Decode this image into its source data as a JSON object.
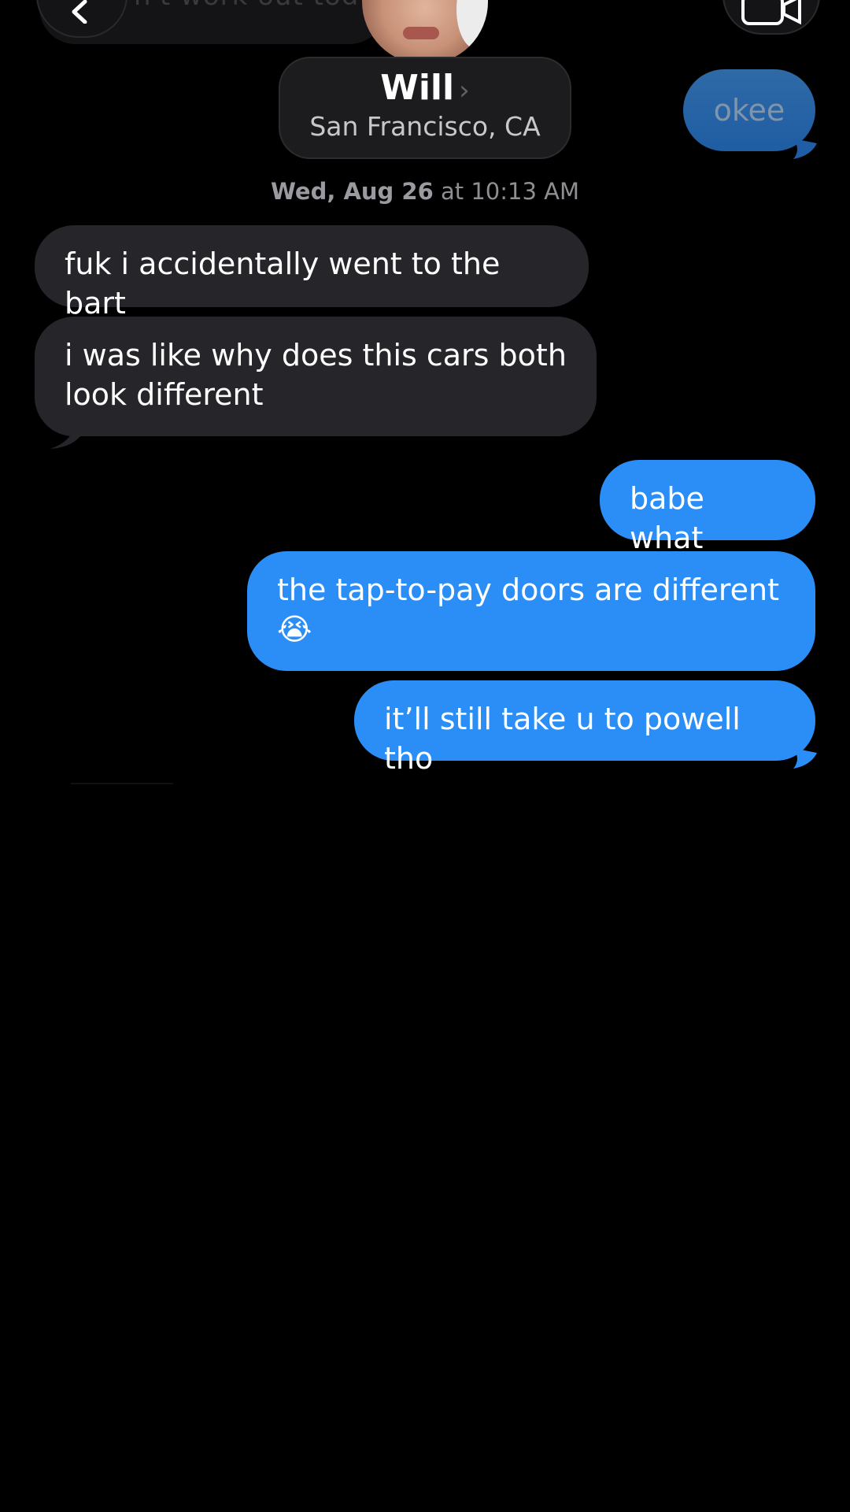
{
  "header": {
    "faded_message": "n't work out tod",
    "contact_name": "Will",
    "contact_location": "San Francisco, CA",
    "chevron": "›"
  },
  "earlier_sent": "okee",
  "timestamp": {
    "day": "Wed, Aug 26",
    "at": "at",
    "time": "10:13 AM"
  },
  "messages": [
    {
      "from": "them",
      "text": "fuk i accidentally went to the bart"
    },
    {
      "from": "them",
      "text": "i was like why does this cars both look different"
    },
    {
      "from": "me",
      "text": "babe what"
    },
    {
      "from": "me",
      "text": "the tap-to-pay doors are different 😭"
    },
    {
      "from": "me",
      "text": "it’ll still take u to powell tho"
    }
  ],
  "icons": [
    "back-chevron-icon",
    "video-camera-icon",
    "contact-avatar"
  ],
  "colors": {
    "sent": "#2b8ef6",
    "received": "#26262a",
    "background": "#000000"
  }
}
